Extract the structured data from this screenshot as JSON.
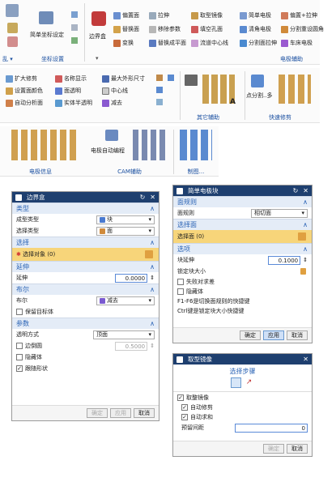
{
  "ribbon1": {
    "g1_main": "简单坐标设定",
    "g1_name": "坐标设置",
    "g1_foot": "乱 ▾",
    "box_main": "边界盒",
    "r1": [
      "偏置面",
      "拉伸",
      "取型镜像",
      "简单电极",
      "偏置+拉伸"
    ],
    "r2": [
      "替换面",
      "移除参数",
      "填空孔面",
      "清角电极",
      "分割重设圆角"
    ],
    "r3": [
      "变换",
      "替换成平面",
      "流道中心线",
      "分割面拉伸",
      "车床电极"
    ],
    "g2_name": "电极辅助",
    "foot_arrow": "▾"
  },
  "ribbon2": {
    "c1": [
      "扩大修剪",
      "名称显示",
      "设置面颜色",
      "面透明",
      "自动分析面",
      "实体半透明"
    ],
    "c2": [
      "最大外形尺寸",
      "中心线",
      "减去"
    ],
    "g1_name": "其它辅助",
    "split_main": "点分割..多",
    "g2_name": "快速修剪"
  },
  "ribbon3": {
    "g1_name": "电极信息",
    "auto_main": "电极自动编程",
    "g2_name": "CAM辅助",
    "g3_name": "制图..."
  },
  "dlg_box": {
    "title": "边界盒",
    "sec_type": "类型",
    "type_label": "成型类型",
    "type_value": "块",
    "sel_type_label": "选择类型",
    "sel_type_value": "面",
    "sec_select": "选择",
    "select_obj": "选择对象 (0)",
    "sec_extend": "延伸",
    "extend_label": "延伸",
    "extend_value": "0.0000",
    "sec_bool": "布尔",
    "bool_label": "布尔",
    "bool_value": "减去",
    "keep_target": "保留目标体",
    "sec_params": "参数",
    "transp_label": "透明方式",
    "transp_value": "顶面",
    "edge_gap_label": "边倒圆",
    "edge_gap_value": "0.5000",
    "hide_label": "隐藏体",
    "follow_label": "跟随形状",
    "btn_ok": "确定",
    "btn_apply": "应用",
    "btn_cancel": "取消"
  },
  "dlg_elec": {
    "title": "简单电极块",
    "sec_face_rule": "面规则",
    "face_rule_label": "面规则",
    "face_rule_value": "相切面",
    "sec_select_face": "选择面",
    "select_face": "选择面 (0)",
    "sec_options": "选项",
    "extend_label": "块延伸",
    "extend_value": "0.1000",
    "lock_label": "锁定块大小",
    "lose_label": "失败对求差",
    "hide_label": "隐藏体",
    "hint1": "F1-F6是切换面规则的快捷键",
    "hint2": "Ctrl键是锁定块大小快捷键",
    "btn_ok": "确定",
    "btn_apply": "应用",
    "btn_cancel": "取消"
  },
  "dlg_mirror": {
    "title": "取型镜像",
    "steps_label": "选择步骤",
    "mirror_label": "取整镜像",
    "auto_trim": "自动修剪",
    "auto_sum": "自动求和",
    "gap_label": "预留间距",
    "gap_value": "0",
    "btn_ok": "确定",
    "btn_cancel": "取消"
  },
  "colors": {
    "header": "#1e3f6f",
    "section": "#2a63b5",
    "highlight": "#f7d57a"
  }
}
